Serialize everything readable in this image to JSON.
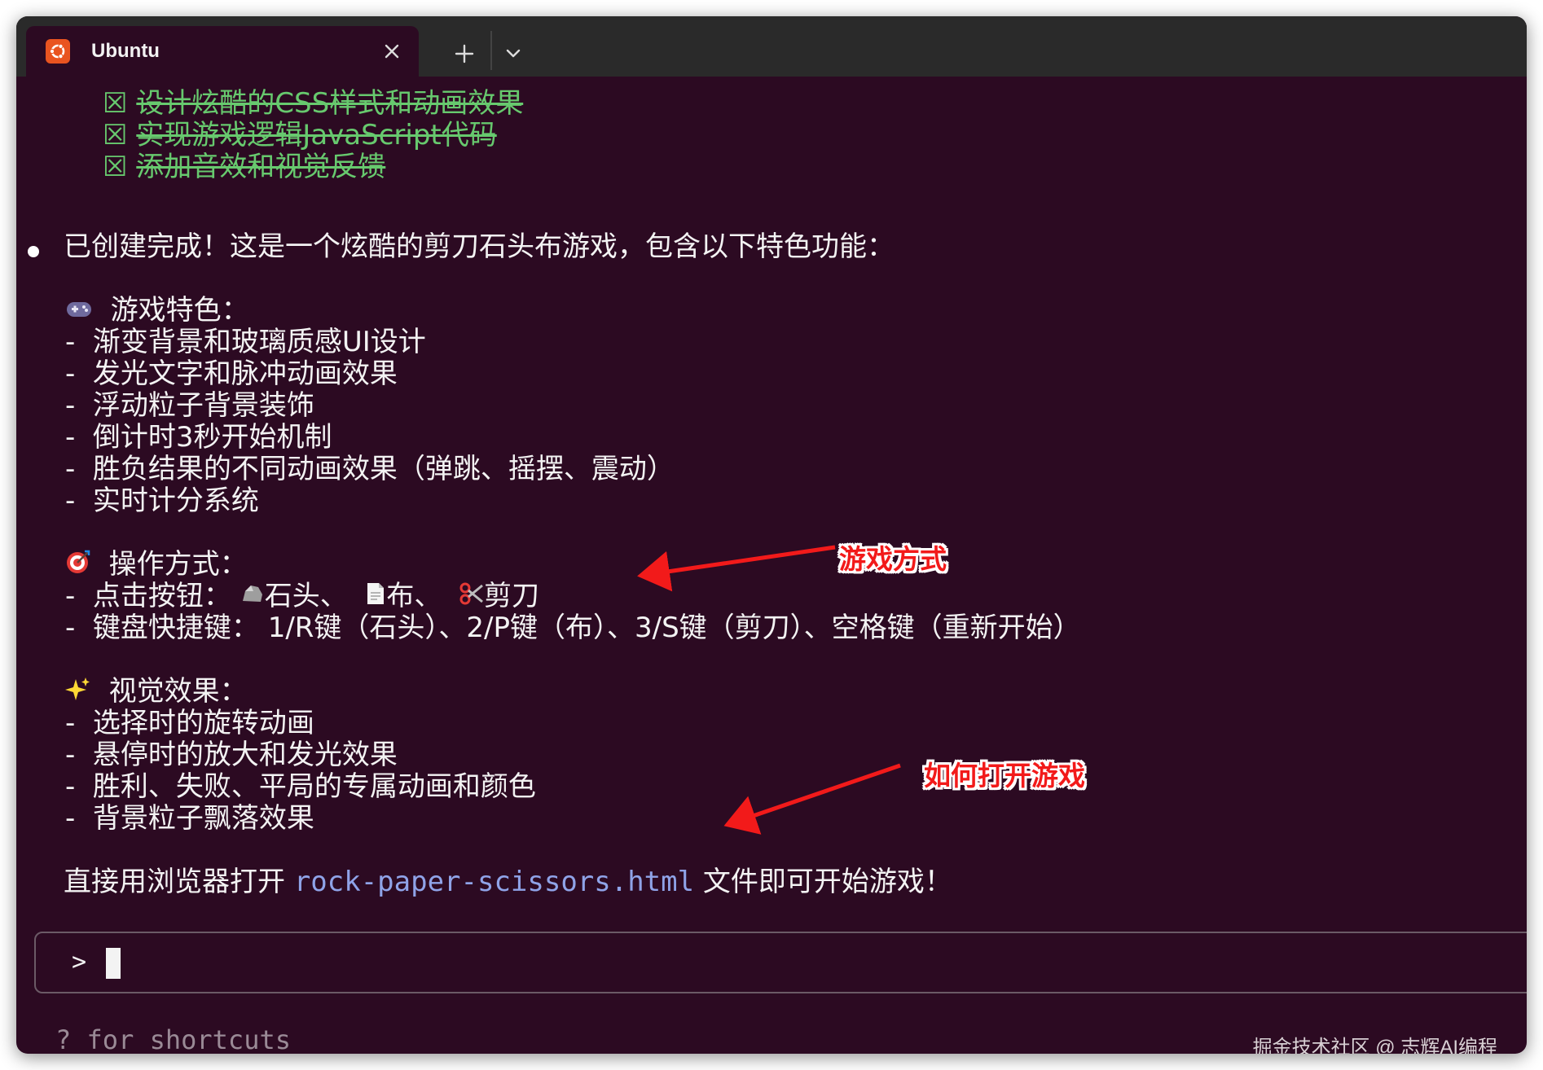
{
  "window": {
    "tab_title": "Ubuntu",
    "tab_icon": "ubuntu-logo-icon",
    "new_tab_icon": "plus-icon",
    "dropdown_icon": "chevron-down-icon",
    "close_icon": "close-icon"
  },
  "todos": [
    {
      "mark": "☒",
      "text": "设计炫酷的CSS样式和动画效果"
    },
    {
      "mark": "☒",
      "text": "实现游戏逻辑JavaScript代码"
    },
    {
      "mark": "☒",
      "text": "添加音效和视觉反馈"
    }
  ],
  "summary": "已创建完成！这是一个炫酷的剪刀石头布游戏，包含以下特色功能：",
  "sections": {
    "features": {
      "icon": "gamepad-icon",
      "heading": "游戏特色：",
      "items": [
        "渐变背景和玻璃质感UI设计",
        "发光文字和脉冲动画效果",
        "浮动粒子背景装饰",
        "倒计时3秒开始机制",
        "胜负结果的不同动画效果（弹跳、摇摆、震动）",
        "实时计分系统"
      ]
    },
    "controls": {
      "icon": "target-icon",
      "heading": "操作方式：",
      "click_prefix": "点击按钮：",
      "click_rock": "石头、",
      "click_paper": "布、",
      "click_scissors": "剪刀",
      "keyboard": "键盘快捷键： 1/R键（石头）、2/P键（布）、3/S键（剪刀）、空格键（重新开始）"
    },
    "visual": {
      "icon": "sparkles-icon",
      "heading": "视觉效果：",
      "items": [
        "选择时的旋转动画",
        "悬停时的放大和发光效果",
        "胜利、失败、平局的专属动画和颜色",
        "背景粒子飘落效果"
      ]
    }
  },
  "closing": {
    "prefix": "直接用浏览器打开 ",
    "filename": "rock-paper-scissors.html",
    "suffix": " 文件即可开始游戏！"
  },
  "annotations": {
    "play_mode": "游戏方式",
    "how_to_open": "如何打开游戏"
  },
  "prompt": {
    "symbol": ">",
    "hint": "? for shortcuts"
  },
  "watermark": "掘金技术社区 @ 志辉AI编程",
  "colors": {
    "background": "#2c0a22",
    "done_text": "#67c96e",
    "filename": "#8fa3e8",
    "annotation": "#f21a1a",
    "tab_icon": "#e95420"
  }
}
